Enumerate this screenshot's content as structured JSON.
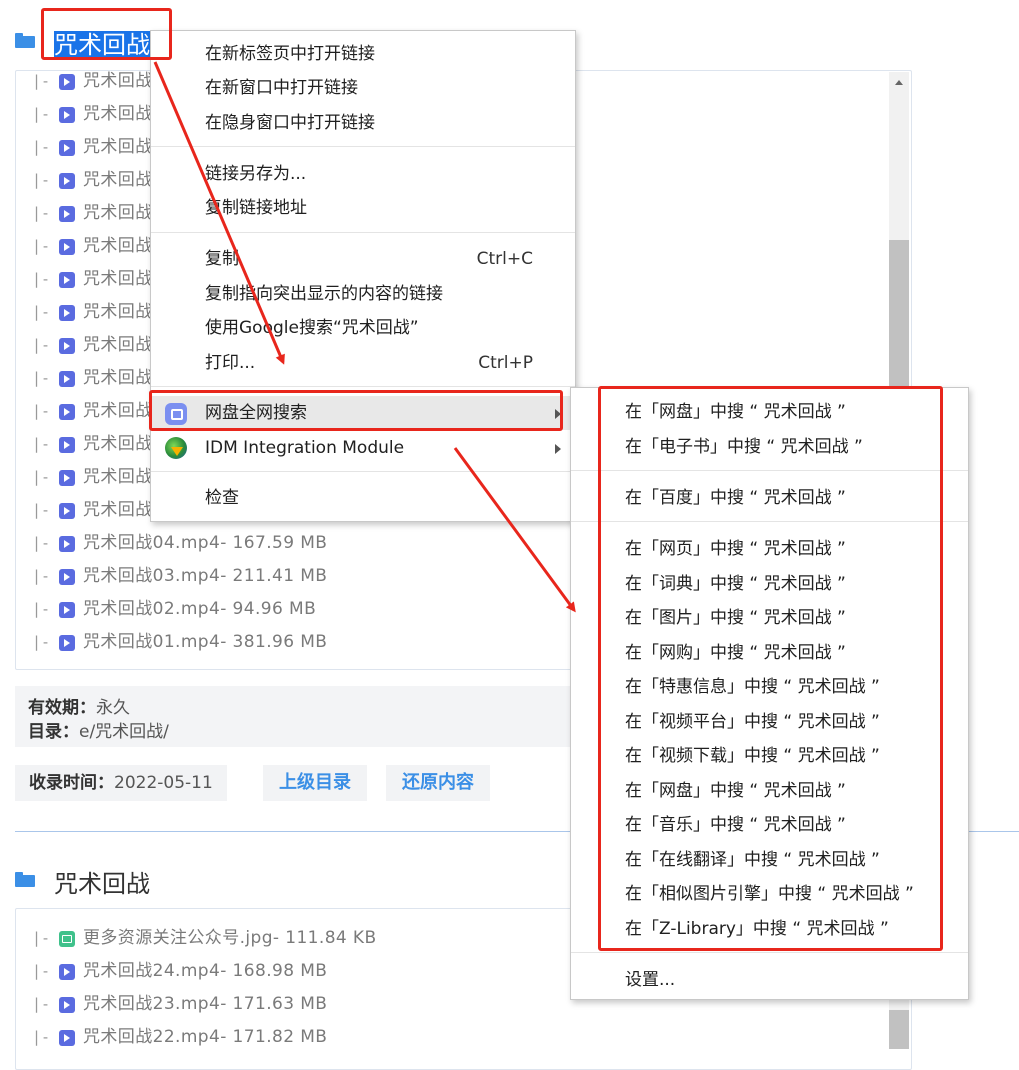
{
  "page": {
    "section1": {
      "title": "咒术回战",
      "files": [
        "咒术回战",
        "咒术回战",
        "咒术回战",
        "咒术回战",
        "咒术回战",
        "咒术回战",
        "咒术回战",
        "咒术回战",
        "咒术回战",
        "咒术回战",
        "咒术回战",
        "咒术回战",
        "咒术回战",
        "咒术回战",
        "咒术回战04.mp4- 167.59 MB",
        "咒术回战03.mp4- 211.41 MB",
        "咒术回战02.mp4- 94.96 MB",
        "咒术回战01.mp4- 381.96 MB"
      ],
      "validity_label": "有效期：",
      "validity_value": "永久",
      "dir_label": "目录：",
      "dir_value": "e/咒术回战/",
      "added_label": "收录时间：",
      "added_value": "2022-05-11",
      "parent_button": "上级目录",
      "restore_button": "还原内容"
    },
    "section2": {
      "title": "咒术回战",
      "files": [
        "更多资源关注公众号.jpg- 111.84 KB",
        "咒术回战24.mp4- 168.98 MB",
        "咒术回战23.mp4- 171.63 MB",
        "咒术回战22.mp4- 171.82 MB"
      ]
    }
  },
  "context_menu": {
    "items": [
      {
        "label": "在新标签页中打开链接"
      },
      {
        "label": "在新窗口中打开链接"
      },
      {
        "label": "在隐身窗口中打开链接"
      },
      {
        "label": "链接另存为..."
      },
      {
        "label": "复制链接地址"
      },
      {
        "label": "复制",
        "shortcut": "Ctrl+C"
      },
      {
        "label": "复制指向突出显示的内容的链接"
      },
      {
        "label": "使用Google搜索“咒术回战”"
      },
      {
        "label": "打印...",
        "shortcut": "Ctrl+P"
      },
      {
        "label": "网盘全网搜索",
        "icon": "cloud-drive-search-icon"
      },
      {
        "label": "IDM Integration Module",
        "icon": "idm-icon"
      },
      {
        "label": "检查"
      }
    ]
  },
  "submenu": {
    "items": [
      "在「网盘」中搜 “ 咒术回战 ”",
      "在「电子书」中搜 “ 咒术回战 ”",
      "在「百度」中搜 “ 咒术回战 ”",
      "在「网页」中搜 “ 咒术回战 ”",
      "在「词典」中搜 “ 咒术回战 ”",
      "在「图片」中搜 “ 咒术回战 ”",
      "在「网购」中搜 “ 咒术回战 ”",
      "在「特惠信息」中搜 “ 咒术回战 ”",
      "在「视频平台」中搜 “ 咒术回战 ”",
      "在「视频下载」中搜 “ 咒术回战 ”",
      "在「网盘」中搜 “ 咒术回战 ”",
      "在「音乐」中搜 “ 咒术回战 ”",
      "在「在线翻译」中搜 “ 咒术回战 ”",
      "在「相似图片引擎」中搜 “ 咒术回战 ”",
      "在「Z-Library」中搜 “ 咒术回战 ”"
    ],
    "settings": "设置..."
  },
  "colors": {
    "annotation": "#e8261c",
    "link_blue": "#3b8fe6",
    "selection": "#1a73e8"
  }
}
